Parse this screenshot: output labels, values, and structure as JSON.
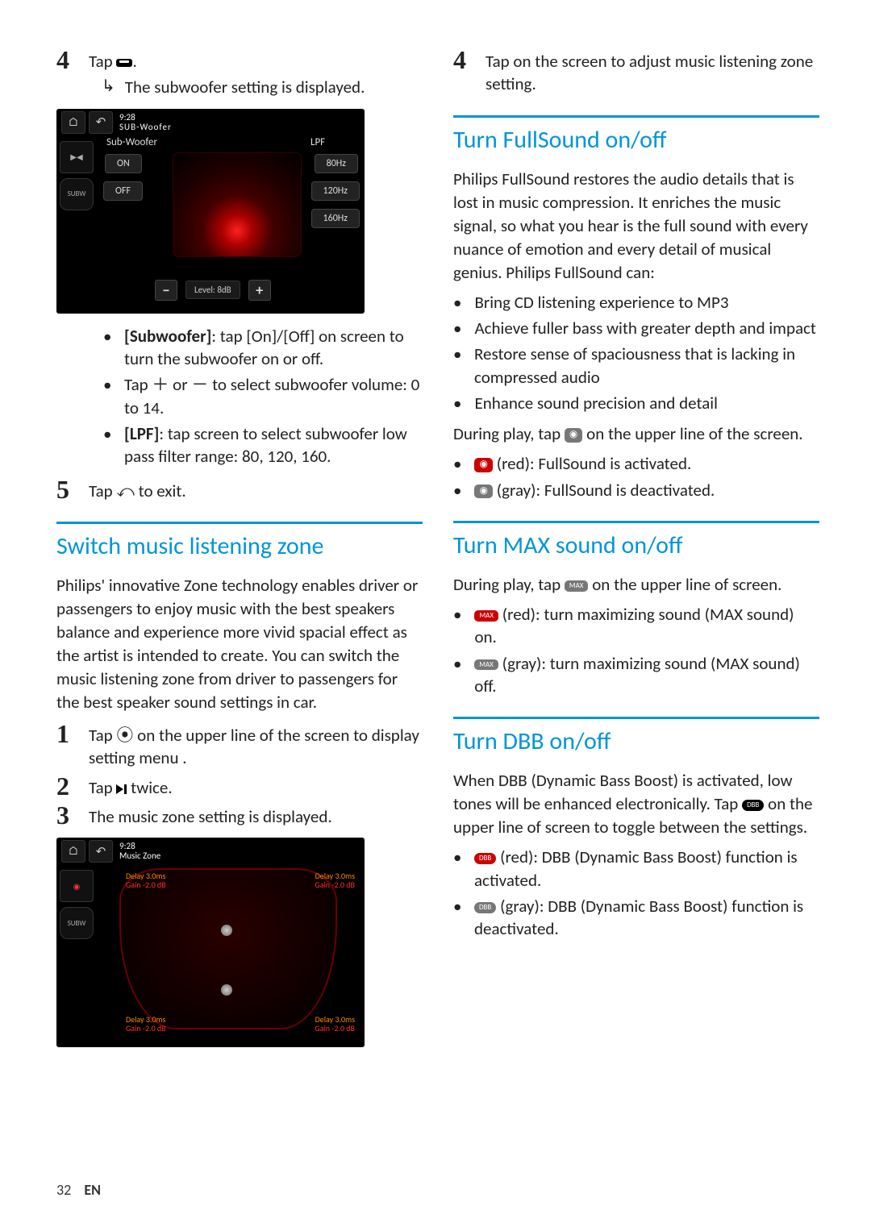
{
  "left": {
    "step4": {
      "text": "Tap",
      "sub": "The subwoofer setting is displayed."
    },
    "screenshot1": {
      "time": "9:28",
      "title": "SUB-Woofer",
      "labelLeft": "Sub-Woofer",
      "labelRight": "LPF",
      "on": "ON",
      "off": "OFF",
      "lpf80": "80Hz",
      "lpf120": "120Hz",
      "lpf160": "160Hz",
      "level": "Level: 8dB",
      "subw": "SUBW"
    },
    "bullets": [
      {
        "pre": "[Subwoofer]",
        "text": ": tap [On]/[Off] on screen to turn the subwoofer on or off."
      },
      {
        "pre": "",
        "text": "Tap ＋ or － to select subwoofer volume: 0 to 14."
      },
      {
        "pre": "[LPF]",
        "text": ": tap screen to select subwoofer low pass filter range: 80, 120, 160."
      }
    ],
    "step5": "Tap ⤺ to exit.",
    "zoneTitle": "Switch music listening zone",
    "zonePara": "Philips' innovative Zone technology enables driver or passengers to enjoy music with the best speakers balance and experience more vivid spacial effect as the artist is intended to create. You can switch the music listening zone from driver to passengers for the best speaker sound settings in car.",
    "zoneSteps": {
      "s1": "Tap ⦿ on the upper line of the screen to display setting menu .",
      "s2": "Tap ▶▎ twice.",
      "s3": "The music zone setting is displayed."
    },
    "screenshot2": {
      "time": "9:28",
      "title": "Music Zone",
      "delay": "Delay 3.0ms",
      "gain": "Gain -2.0 dB",
      "subw": "SUBW"
    }
  },
  "right": {
    "step4": "Tap on the screen to adjust music listening zone setting.",
    "fsTitle": "Turn FullSound on/off",
    "fsPara": "Philips FullSound restores the audio details that is lost in music compression. It enriches the music signal, so what you hear is the full sound with every nuance of emotion and every detail of musical genius. Philips FullSound can:",
    "fsBullets": [
      "Bring CD listening experience to MP3",
      "Achieve fuller bass with greater depth and impact",
      "Restore sense of spaciousness that is lacking in compressed audio",
      "Enhance sound precision and detail"
    ],
    "fsDuring": "During play, tap ⦿ on the upper line of the screen.",
    "fsStates": {
      "red": "(red): FullSound is activated.",
      "gray": "(gray): FullSound is deactivated."
    },
    "maxTitle": "Turn MAX sound on/off",
    "maxDuring": "During play, tap ⦿ on the upper line of screen.",
    "maxStates": {
      "red": "(red): turn maximizing sound (MAX sound) on.",
      "gray": "(gray): turn maximizing sound (MAX sound) off."
    },
    "dbbTitle": "Turn DBB on/off",
    "dbbPara": "When DBB (Dynamic Bass Boost) is activated, low tones will be enhanced electronically. Tap ⦿ on the upper line of screen to toggle between the settings.",
    "dbbStates": {
      "red": "(red): DBB (Dynamic Bass Boost) function is activated.",
      "gray": "(gray): DBB (Dynamic Bass Boost) function is deactivated."
    }
  },
  "footer": {
    "page": "32",
    "lang": "EN"
  }
}
